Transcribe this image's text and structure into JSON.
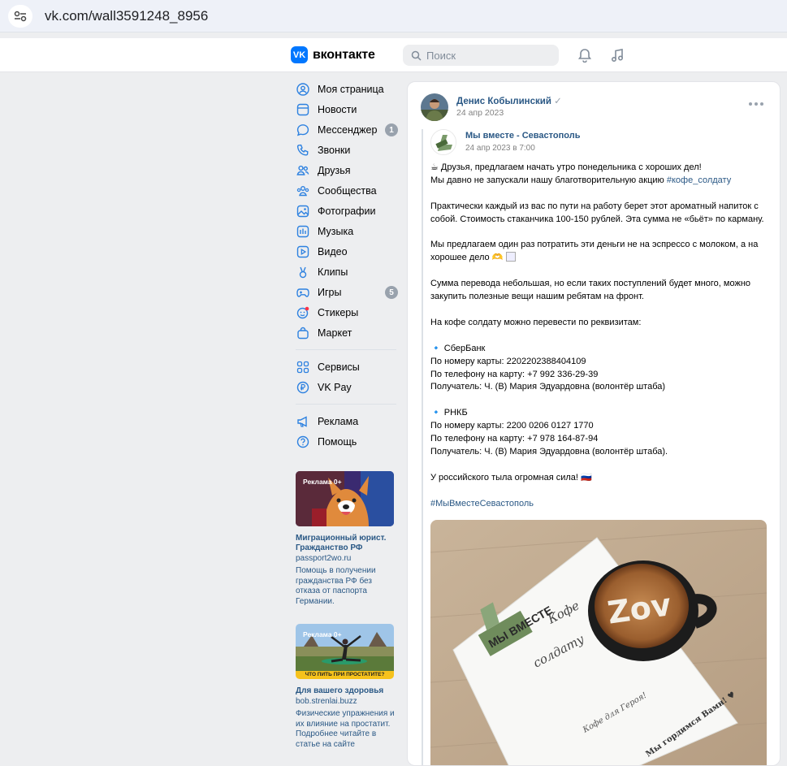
{
  "browser": {
    "url": "vk.com/wall3591248_8956"
  },
  "header": {
    "logo_mark": "VK",
    "logo_text": "вконтакте",
    "search_placeholder": "Поиск",
    "icons": [
      "bell-icon",
      "music-icon"
    ]
  },
  "nav": {
    "items": [
      {
        "label": "Моя страница",
        "icon": "user-icon",
        "badge": ""
      },
      {
        "label": "Новости",
        "icon": "news-icon",
        "badge": ""
      },
      {
        "label": "Мессенджер",
        "icon": "message-icon",
        "badge": "1"
      },
      {
        "label": "Звонки",
        "icon": "phone-icon",
        "badge": ""
      },
      {
        "label": "Друзья",
        "icon": "friends-icon",
        "badge": ""
      },
      {
        "label": "Сообщества",
        "icon": "communities-icon",
        "badge": ""
      },
      {
        "label": "Фотографии",
        "icon": "photo-icon",
        "badge": ""
      },
      {
        "label": "Музыка",
        "icon": "music-icon",
        "badge": ""
      },
      {
        "label": "Видео",
        "icon": "video-icon",
        "badge": ""
      },
      {
        "label": "Клипы",
        "icon": "clips-icon",
        "badge": ""
      },
      {
        "label": "Игры",
        "icon": "games-icon",
        "badge": "5"
      },
      {
        "label": "Стикеры",
        "icon": "stickers-icon",
        "badge": ""
      },
      {
        "label": "Маркет",
        "icon": "market-icon",
        "badge": ""
      }
    ],
    "services": [
      {
        "label": "Сервисы",
        "icon": "services-icon"
      },
      {
        "label": "VK Pay",
        "icon": "vkpay-icon"
      }
    ],
    "extra": [
      {
        "label": "Реклама",
        "icon": "megaphone-icon"
      },
      {
        "label": "Помощь",
        "icon": "help-icon"
      }
    ]
  },
  "ads": [
    {
      "label": "Реклама 0+",
      "title": "Миграционный юрист. Гражданство РФ",
      "domain": "passport2wo.ru",
      "desc": "Помощь в получении гражданства РФ без отказа от паспорта Германии.",
      "image_caption": ""
    },
    {
      "label": "Реклама 0+",
      "title": "Для вашего здоровья",
      "domain": "bob.strenlai.buzz",
      "desc": "Физические упражнения и их влияние на простатит. Подробнее читайте в статье на сайте",
      "image_caption": "ЧТО ПИТЬ ПРИ ПРОСТАТИТЕ?"
    }
  ],
  "post": {
    "author": "Денис Кобылинский",
    "date": "24 апр 2023",
    "repost": {
      "group": "Мы вместе - Севастополь",
      "date": "24 апр 2023 в 7:00"
    },
    "text": {
      "line1": "☕ Друзья, предлагаем начать утро понедельника с хороших дел!",
      "line2_prefix": "Мы давно не запускали нашу благотворительную акцию ",
      "line2_tag": "#кофе_солдату",
      "para2": "Практически каждый из вас по пути на работу берет этот ароматный напиток с собой. Стоимость стаканчика 100-150 рублей. Эта сумма не «бьёт» по карману.",
      "para3": "Мы предлагаем один раз потратить эти деньги не на эспрессо с молоком, а на хорошее дело 🫶",
      "para4": "Сумма перевода небольшая, но если таких поступлений будет много, можно закупить полезные вещи нашим ребятам на фронт.",
      "para5": "На кофе солдату можно перевести по реквизитам:",
      "bank1": {
        "name": "🔹 СберБанк",
        "card": "По номеру карты: 2202202388404109",
        "phone": "По телефону на карту: +7 992 336-29-39",
        "recipient": "Получатель: Ч. (В) Мария Эдуардовна (волонтёр штаба)"
      },
      "bank2": {
        "name": "🔹 РНКБ",
        "card": "По номеру карты: 2200 0206 0127 1770",
        "phone": "По телефону на карту: +7 978 164-87-94",
        "recipient": "Получатель: Ч. (В) Мария Эдуардовна (волонтёр штаба)."
      },
      "para6": "У российского тыла огромная сила! 🇷🇺",
      "hashtag": "#МыВместеСевастополь"
    },
    "photo": {
      "cup_text": "Zov",
      "logo_text": "МЫ ВМЕСТЕ",
      "note_lines": [
        "Кофе",
        "солдату"
      ],
      "note_bottom": "Мы гордимся Вами! ♥",
      "note_side": "Кофе для Героя!"
    }
  }
}
